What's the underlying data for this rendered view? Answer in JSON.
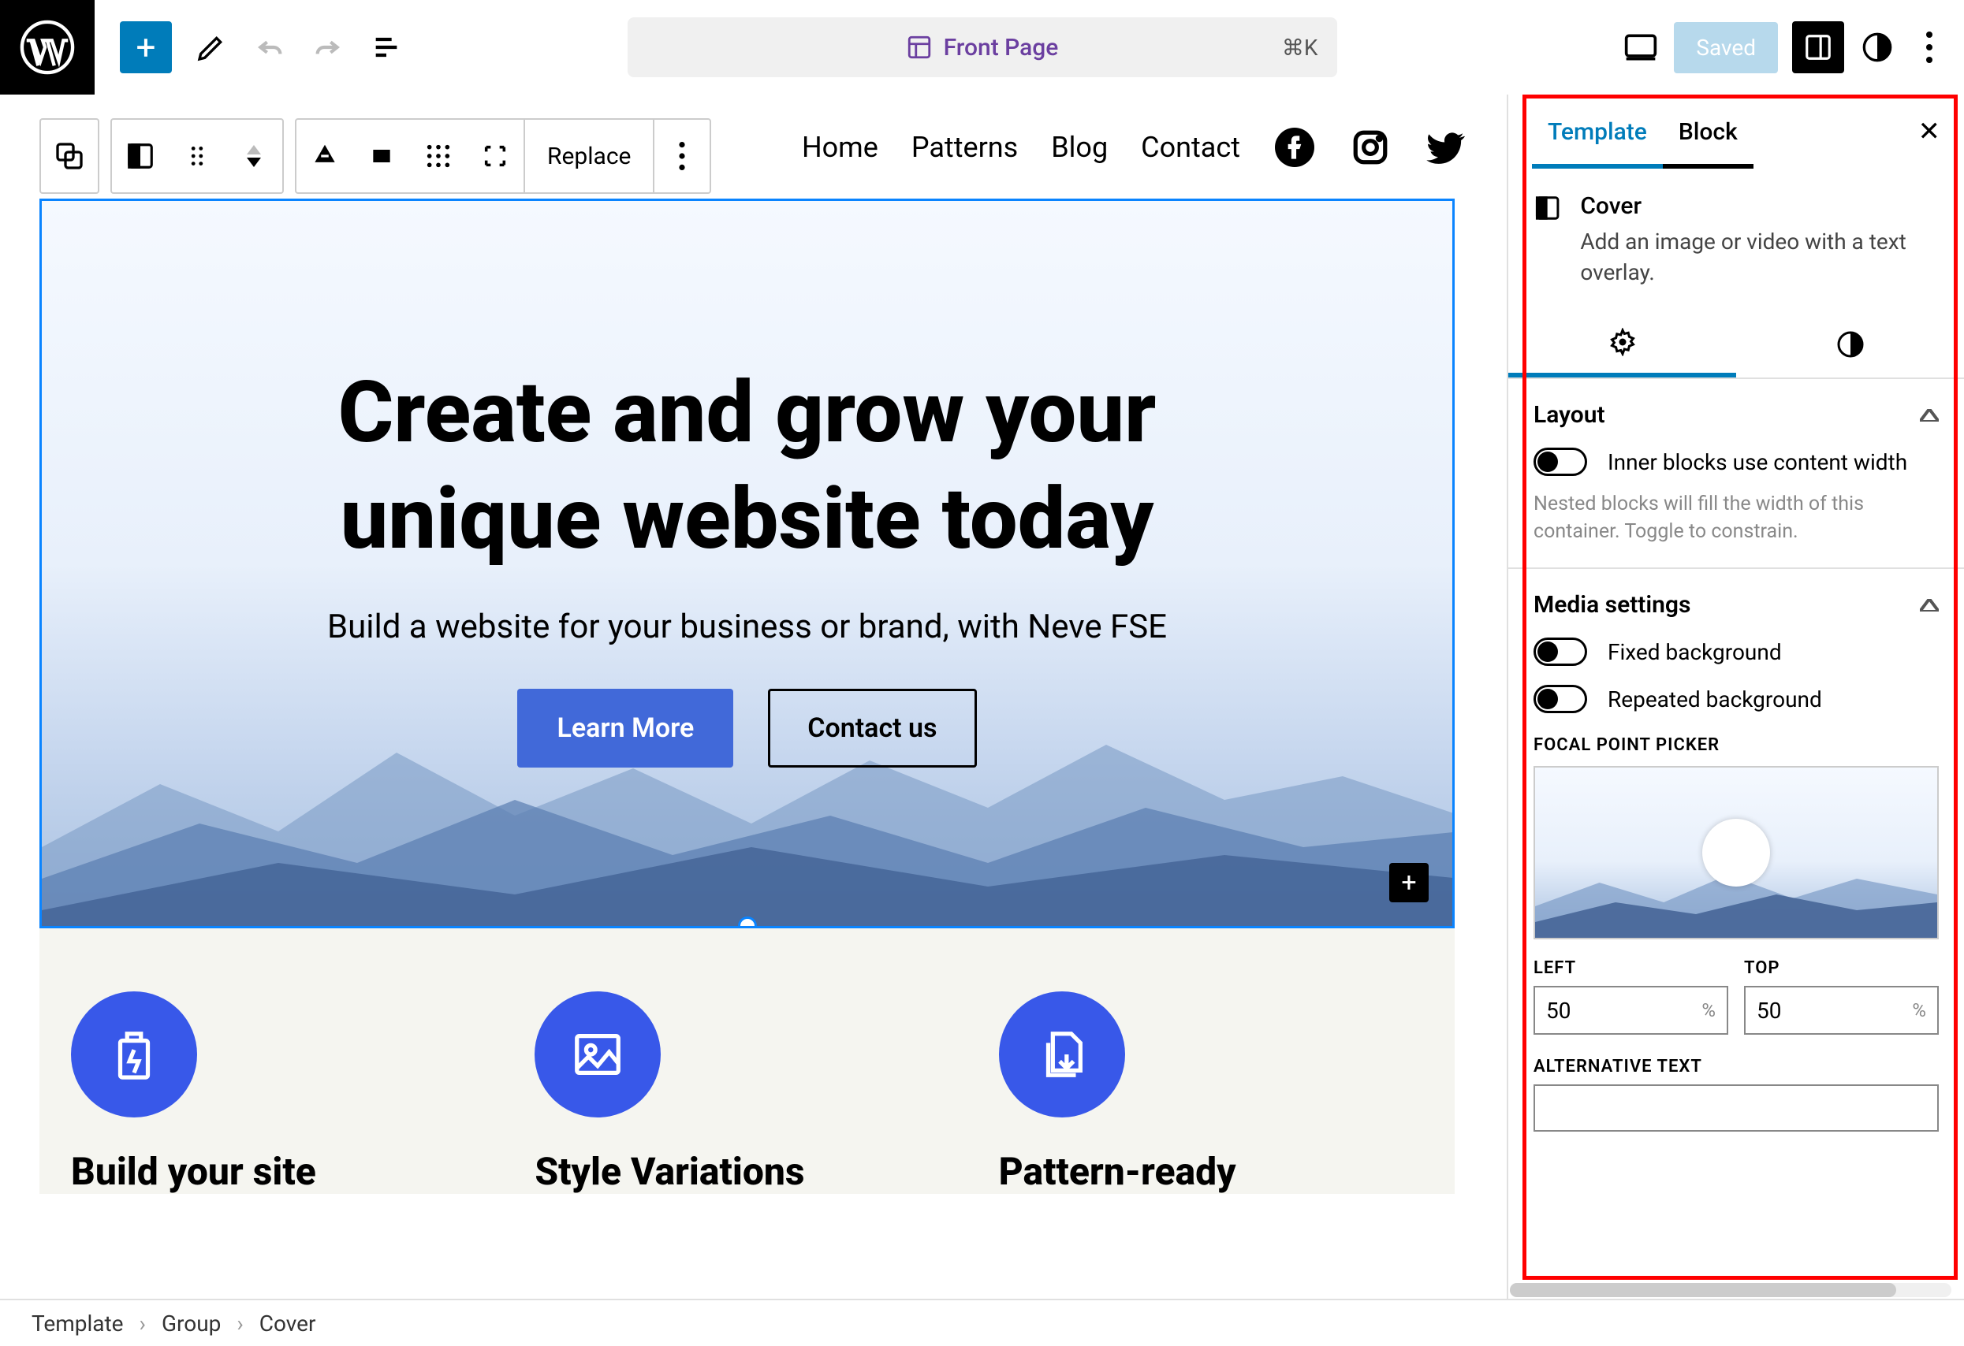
{
  "top": {
    "doc_title": "Front Page",
    "shortcut": "⌘K",
    "saved": "Saved"
  },
  "block_toolbar": {
    "replace": "Replace"
  },
  "nav": {
    "items": [
      "Home",
      "Patterns",
      "Blog",
      "Contact"
    ]
  },
  "cover": {
    "heading_l1": "Create and grow your",
    "heading_l2": "unique website today",
    "sub": "Build a website for your business or brand, with Neve FSE",
    "btn1": "Learn More",
    "btn2": "Contact us"
  },
  "features": [
    {
      "title": "Build your site"
    },
    {
      "title": "Style Variations"
    },
    {
      "title": "Pattern-ready"
    }
  ],
  "sidebar": {
    "tabs": {
      "template": "Template",
      "block": "Block"
    },
    "block_name": "Cover",
    "block_desc": "Add an image or video with a text overlay.",
    "layout": {
      "title": "Layout",
      "toggle": "Inner blocks use content width",
      "help": "Nested blocks will fill the width of this container. Toggle to constrain."
    },
    "media": {
      "title": "Media settings",
      "fixed": "Fixed background",
      "repeated": "Repeated background",
      "focal_label": "FOCAL POINT PICKER",
      "left_label": "LEFT",
      "top_label": "TOP",
      "left_value": "50",
      "top_value": "50",
      "pct": "%",
      "alt_label": "ALTERNATIVE TEXT"
    }
  },
  "breadcrumb": [
    "Template",
    "Group",
    "Cover"
  ]
}
